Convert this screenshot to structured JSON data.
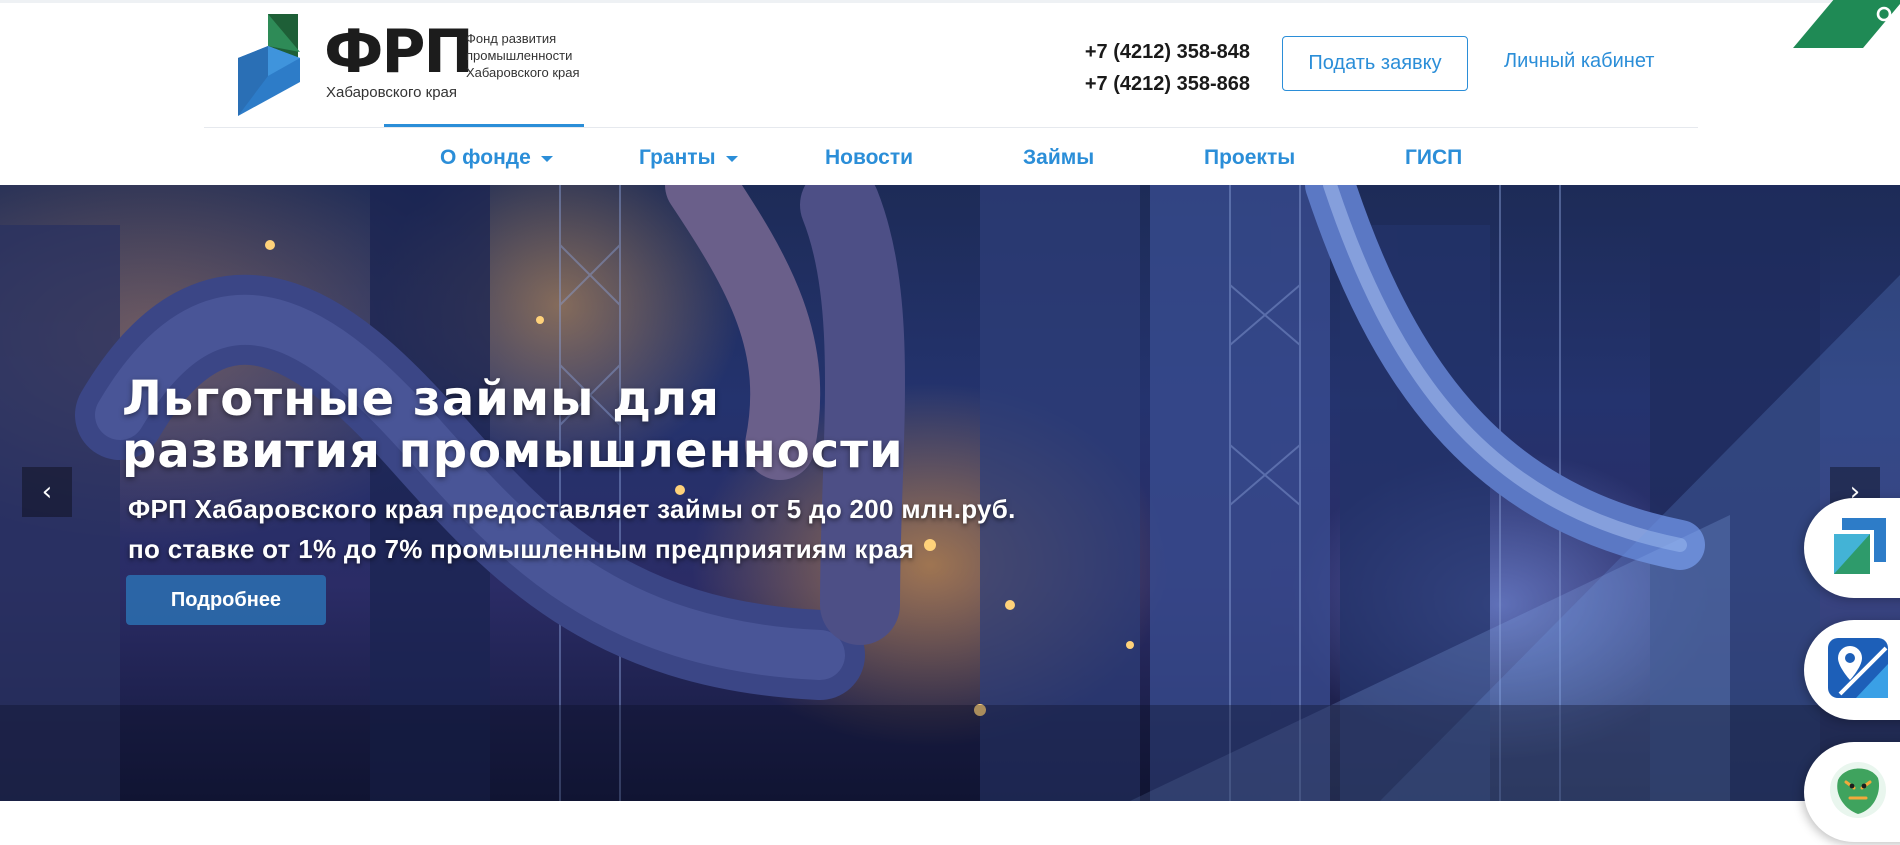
{
  "header": {
    "logo": {
      "abbr": "ФРП",
      "region": "Хабаровского края",
      "desc_line1": "Фонд развития",
      "desc_line2": "промышленности",
      "desc_line3": "Хабаровского края"
    },
    "phones": [
      "+7 (4212) 358-848",
      "+7 (4212) 358-868"
    ],
    "apply_label": "Подать заявку",
    "cabinet_label": "Личный кабинет"
  },
  "nav": {
    "items": [
      {
        "label": "О фонде",
        "dropdown": true,
        "active": true
      },
      {
        "label": "Гранты",
        "dropdown": true,
        "active": false
      },
      {
        "label": "Новости",
        "dropdown": false,
        "active": false
      },
      {
        "label": "Займы",
        "dropdown": false,
        "active": false
      },
      {
        "label": "Проекты",
        "dropdown": false,
        "active": false
      },
      {
        "label": "ГИСП",
        "dropdown": false,
        "active": false
      }
    ]
  },
  "hero": {
    "title_line1": "Льготные займы для",
    "title_line2": "развития промышленности",
    "subtitle_line1": "ФРП Хабаровского края предоставляет займы от 5 до 200 млн.руб.",
    "subtitle_line2": "по ставке от 1% до 7% промышленным предприятиям края",
    "button_label": "Подробнее",
    "prev_arrow": "‹",
    "next_arrow": "›"
  },
  "colors": {
    "accent": "#2b8ed8",
    "logo_green": "#2e8b57",
    "logo_blue": "#2d7cc8",
    "corner_green": "#1f8a55"
  },
  "icons": {
    "corner": "search-icon",
    "badge_1": "frp-logo-icon",
    "badge_2": "map-pin-icon",
    "badge_3": "tiger-emblem-icon"
  }
}
